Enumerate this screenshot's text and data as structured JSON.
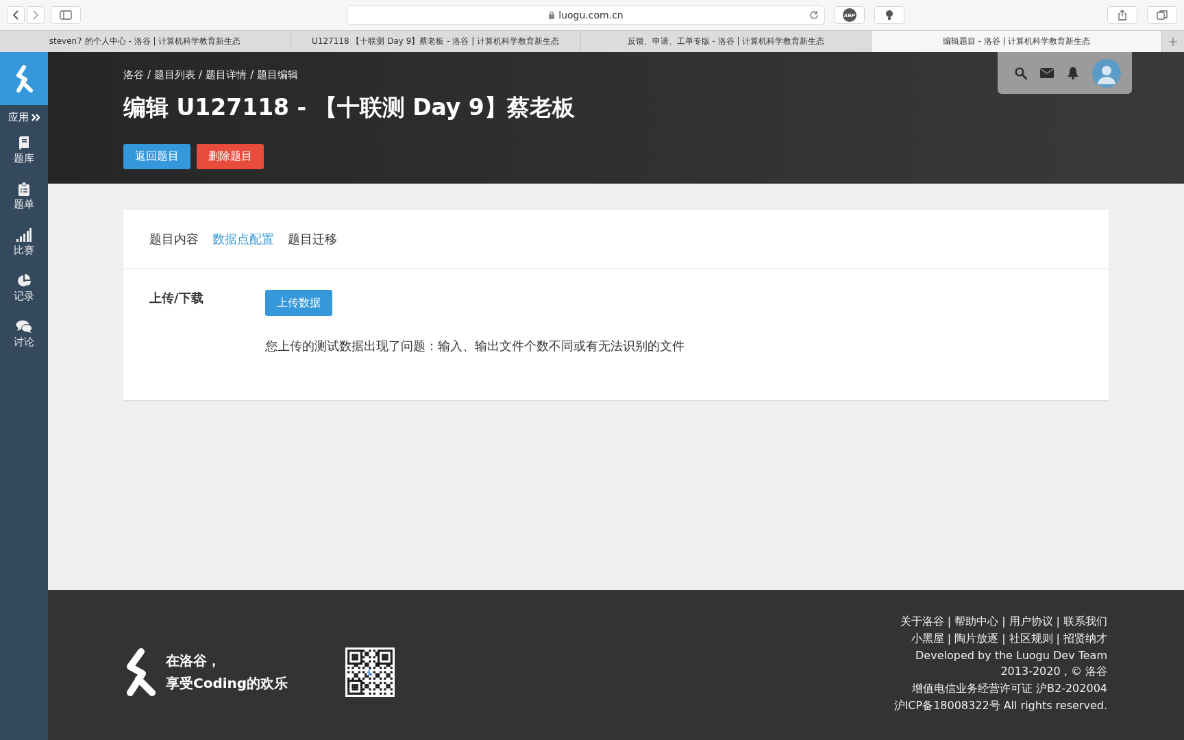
{
  "browser": {
    "address": "luogu.com.cn",
    "adblock_badge": "ABP",
    "tabs": [
      {
        "label": "steven7 的个人中心 - 洛谷 | 计算机科学教育新生态",
        "selected": false
      },
      {
        "label": "U127118 【十联测 Day 9】蔡老板 - 洛谷 | 计算机科学教育新生态",
        "selected": false
      },
      {
        "label": "反馈、申请、工单专版 - 洛谷 | 计算机科学教育新生态",
        "selected": false
      },
      {
        "label": "编辑题目 - 洛谷 | 计算机科学教育新生态",
        "selected": true
      }
    ]
  },
  "sidebar": {
    "apps_label": "应用",
    "items": [
      {
        "label": "题库",
        "kind": "book"
      },
      {
        "label": "题单",
        "kind": "clipboard"
      },
      {
        "label": "比赛",
        "kind": "bars"
      },
      {
        "label": "记录",
        "kind": "pie"
      },
      {
        "label": "讨论",
        "kind": "chat"
      }
    ]
  },
  "header": {
    "breadcrumb": [
      "洛谷",
      "题目列表",
      "题目详情",
      "题目编辑"
    ],
    "breadcrumb_separator": "/",
    "title": "编辑 U127118 - 【十联测 Day 9】蔡老板",
    "buttons": [
      {
        "label": "返回题目",
        "kind": "primary"
      },
      {
        "label": "删除题目",
        "kind": "danger"
      }
    ]
  },
  "card": {
    "tabs": [
      {
        "label": "题目内容",
        "selected": false
      },
      {
        "label": "数据点配置",
        "selected": true
      },
      {
        "label": "题目迁移",
        "selected": false
      }
    ],
    "section_label": "上传/下载",
    "upload_button": "上传数据",
    "message": "您上传的测试数据出现了问题：输入、输出文件个数不同或有无法识别的文件"
  },
  "footer": {
    "slogan": [
      "在洛谷，",
      "享受Coding的欢乐"
    ],
    "separator": "|",
    "link_rows": [
      [
        "关于洛谷",
        "帮助中心",
        "用户协议",
        "联系我们"
      ],
      [
        "小黑屋",
        "陶片放逐",
        "社区规则",
        "招贤纳才"
      ]
    ],
    "lines": [
      "Developed by the Luogu Dev Team",
      "2013-2020 , © 洛谷",
      "增值电信业务经营许可证 沪B2-202004",
      "沪ICP备18008322号 All rights reserved."
    ]
  }
}
